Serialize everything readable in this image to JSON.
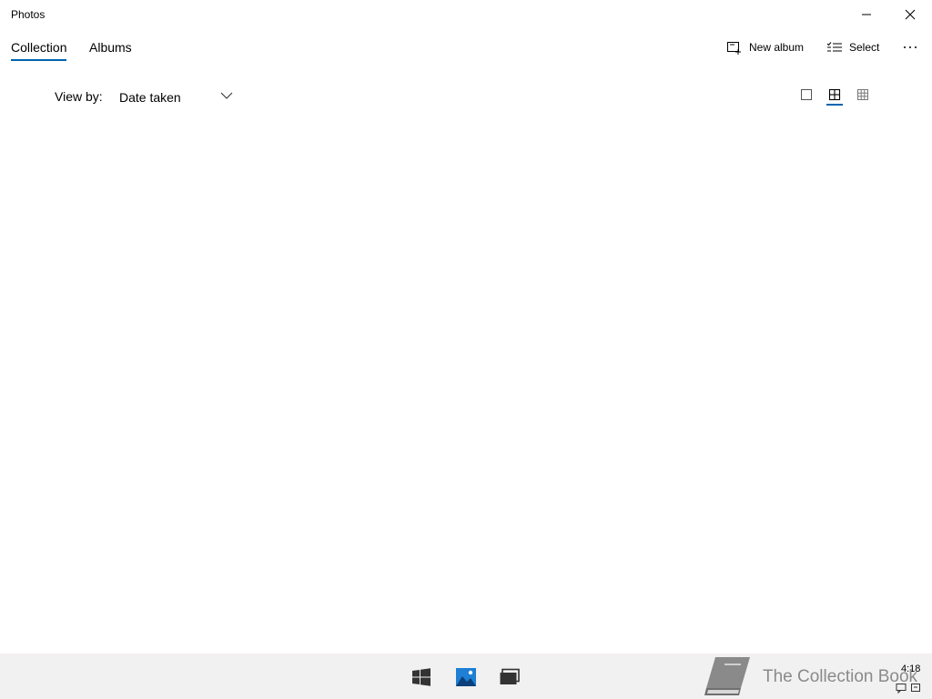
{
  "window": {
    "title": "Photos"
  },
  "tabs": [
    {
      "label": "Collection",
      "active": true
    },
    {
      "label": "Albums",
      "active": false
    }
  ],
  "toolbar": {
    "new_album_label": "New album",
    "select_label": "Select"
  },
  "view_by": {
    "label": "View by:",
    "selected": "Date taken"
  },
  "size_options": [
    "large-tiles",
    "medium-tiles",
    "small-tiles"
  ],
  "selected_size": "medium-tiles",
  "taskbar": {
    "time": "4:18"
  },
  "watermark": {
    "text": "The Collection Book"
  },
  "colors": {
    "accent": "#0063b1",
    "taskbar_bg": "#f1f1f1"
  }
}
